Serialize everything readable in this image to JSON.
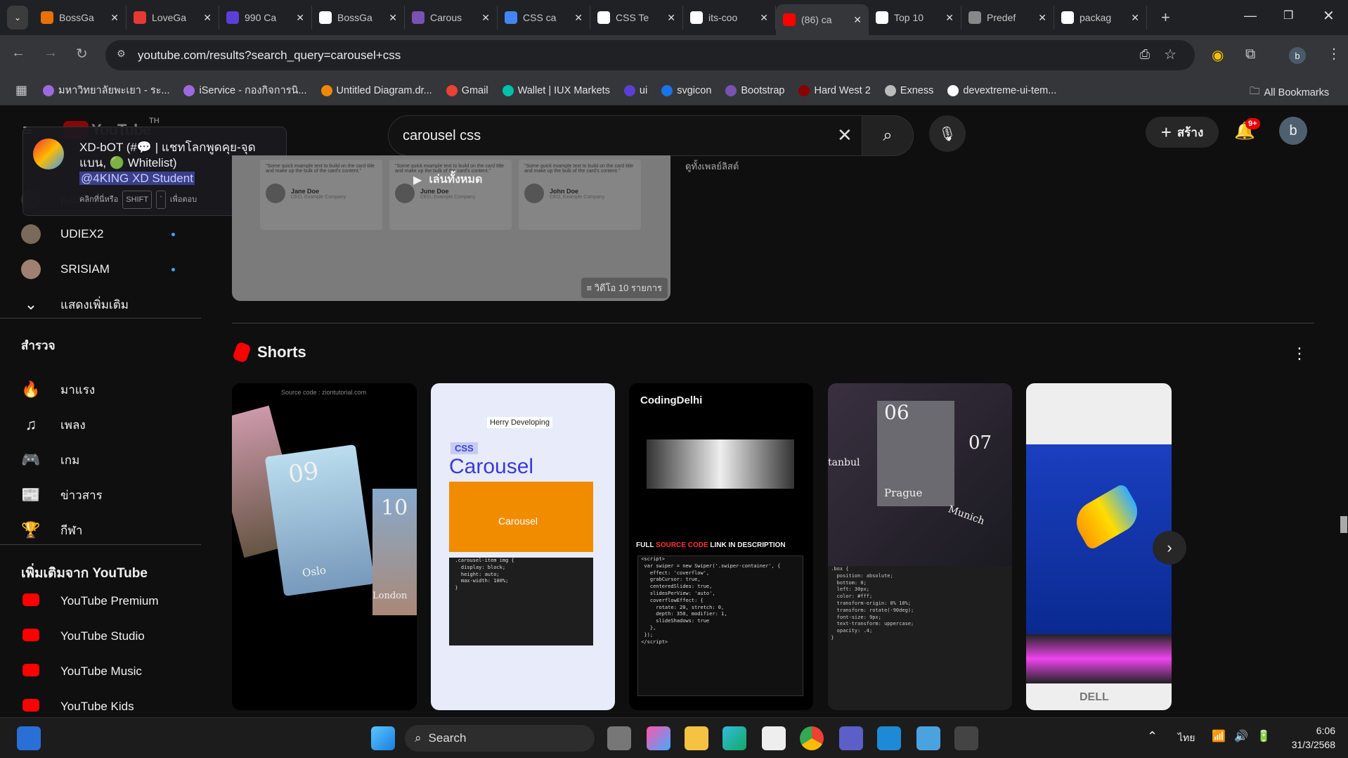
{
  "browser": {
    "tabs": [
      {
        "title": "BossGa",
        "color": "#e8710a"
      },
      {
        "title": "LoveGa",
        "color": "#e53935"
      },
      {
        "title": "990 Ca",
        "color": "#5b3fd6"
      },
      {
        "title": "BossGa",
        "color": "#ffffff"
      },
      {
        "title": "Carous",
        "color": "#7952b3"
      },
      {
        "title": "CSS ca",
        "color": "#4285f4"
      },
      {
        "title": "CSS Te",
        "color": "#ffffff"
      },
      {
        "title": "its-coo",
        "color": "#ffffff"
      },
      {
        "title": "(86) ca",
        "color": "#ff0000",
        "active": true
      },
      {
        "title": "Top 10",
        "color": "#ffffff"
      },
      {
        "title": "Predef",
        "color": "#888888"
      },
      {
        "title": "packag",
        "color": "#ffffff"
      }
    ],
    "url": "youtube.com/results?search_query=carousel+css",
    "profile": "b",
    "bookmarks": [
      {
        "label": "มหาวิทยาลัยพะเยา - ระ...",
        "color": "#9c6ade"
      },
      {
        "label": "iService - กองกิจการนิ...",
        "color": "#9c6ade"
      },
      {
        "label": "Untitled Diagram.dr...",
        "color": "#f08705"
      },
      {
        "label": "Gmail",
        "color": "#ea4335"
      },
      {
        "label": "Wallet | IUX Markets",
        "color": "#00c2a8"
      },
      {
        "label": "ui",
        "color": "#5b3fd6"
      },
      {
        "label": "svgicon",
        "color": "#1a73e8"
      },
      {
        "label": "Bootstrap",
        "color": "#7952b3"
      },
      {
        "label": "Hard West 2",
        "color": "#8b0000"
      },
      {
        "label": "Exness",
        "color": "#bbbbbb"
      },
      {
        "label": "devextreme-ui-tem...",
        "color": "#ffffff"
      }
    ],
    "all_bookmarks": "All Bookmarks"
  },
  "youtube": {
    "logo": "YouTube",
    "region": "TH",
    "search_value": "carousel css",
    "create_label": "สร้าง",
    "notif_badge": "9+",
    "avatar": "b",
    "popup": {
      "line1": "XD-bOT (#💬 | แชทโลกพูดคุย-จุด",
      "line2": "แบน, 🟢 Whitelist)",
      "mention": "@4KING XD Student",
      "hint": "คลิกที่นี่หรือ",
      "key1": "SHIFT",
      "key2": "`",
      "hint2": "เพื่อตอบ"
    },
    "sidebar": {
      "subs": [
        {
          "name": "padiloed"
        },
        {
          "name": "UDIEX2"
        },
        {
          "name": "SRISIAM"
        }
      ],
      "show_more": "แสดงเพิ่มเติม",
      "explore_title": "สำรวจ",
      "explore": [
        {
          "label": "มาแรง",
          "icon": "🔥"
        },
        {
          "label": "เพลง",
          "icon": "♫"
        },
        {
          "label": "เกม",
          "icon": "🎮"
        },
        {
          "label": "ข่าวสาร",
          "icon": "📰"
        },
        {
          "label": "กีฬา",
          "icon": "🏆"
        }
      ],
      "more_title": "เพิ่มเติมจาก YouTube",
      "more": [
        {
          "label": "YouTube Premium"
        },
        {
          "label": "YouTube Studio"
        },
        {
          "label": "YouTube Music"
        },
        {
          "label": "YouTube Kids"
        }
      ]
    },
    "playlist": {
      "play_all": "เล่นทั้งหมด",
      "count": "วิดีโอ 10 รายการ",
      "view_full": "ดูทั้งเพลย์ลิสต์",
      "cards": [
        {
          "quote": "\"Some quick example text to build on the card title and make up the bulk of the card's content.\"",
          "name": "Jane Doe",
          "role": "CEO, Example Company"
        },
        {
          "quote": "\"Some quick example text to build on the card title and make up the bulk of the card's content.\"",
          "name": "June Doe",
          "role": "CEO, Example Company"
        },
        {
          "quote": "\"Some quick example text to build on the card title and make up the bulk of the card's content.\"",
          "name": "John Doe",
          "role": "CEO, Example Company"
        }
      ]
    },
    "shorts": {
      "title": "Shorts",
      "items": [
        {
          "top": "Source code : ziontutorial.com",
          "cities": [
            "Oslo",
            "London"
          ],
          "num1": "09",
          "num2": "10"
        },
        {
          "author": "Herry Developing",
          "badge": "CSS",
          "title": "Carousel",
          "inner": "Carousel"
        },
        {
          "brand": "CodingDelhi",
          "caption_a": "FULL ",
          "caption_b": "SOURCE CODE",
          "caption_c": " LINK IN DESCRIPTION"
        },
        {
          "cities": [
            "Prague",
            "Munich",
            "tanbul"
          ],
          "num1": "06",
          "num2": "07"
        },
        {
          "brand": "DELL"
        }
      ]
    }
  },
  "taskbar": {
    "search": "Search",
    "lang": "ไทย",
    "time": "6:06",
    "date": "31/3/2568"
  }
}
